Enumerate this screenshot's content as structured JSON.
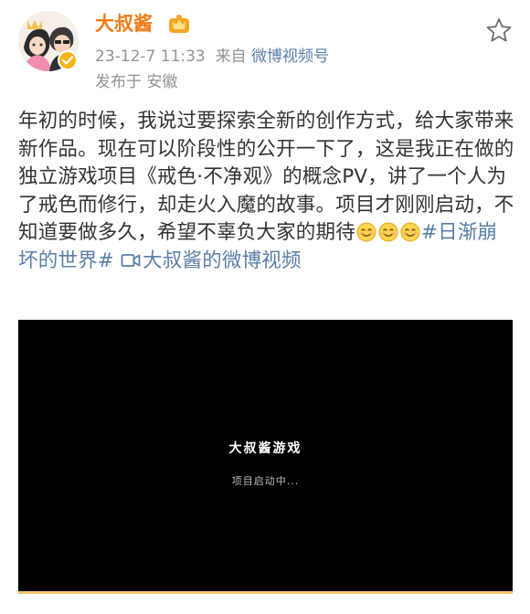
{
  "post": {
    "author": {
      "name": "大叔酱",
      "avatar_icon": "avatar-icon",
      "verified_icon": "verified-badge-icon",
      "vip_icon": "vip-crown-icon"
    },
    "timestamp": "23-12-7 11:33",
    "source_prefix": "来自",
    "source": "微博视频号",
    "location": "发布于 安徽",
    "text_part1": "年初的时候，我说过要探索全新的创作方式，给大家带来新作品。现在可以阶段性的公开一下了，这是我正在做的独立游戏项目《戒色·不净观》的概念PV，讲了一个人为了戒色而修行，却走火入魔的故事。项目才刚刚启动，不知道要做多久，希望不辜负大家的期待",
    "emoji_name": "smile-emoji",
    "hashtag": "#日渐崩坏的世界#",
    "video_link_label": "大叔酱的微博视频",
    "video": {
      "title": "大叔酱游戏",
      "subtitle": "项目启动中..."
    }
  },
  "colors": {
    "accent_orange": "#f27b14",
    "link_blue": "#5a7ea6",
    "meta_gray": "#939393",
    "text": "#333333",
    "video_bg": "#000000"
  }
}
